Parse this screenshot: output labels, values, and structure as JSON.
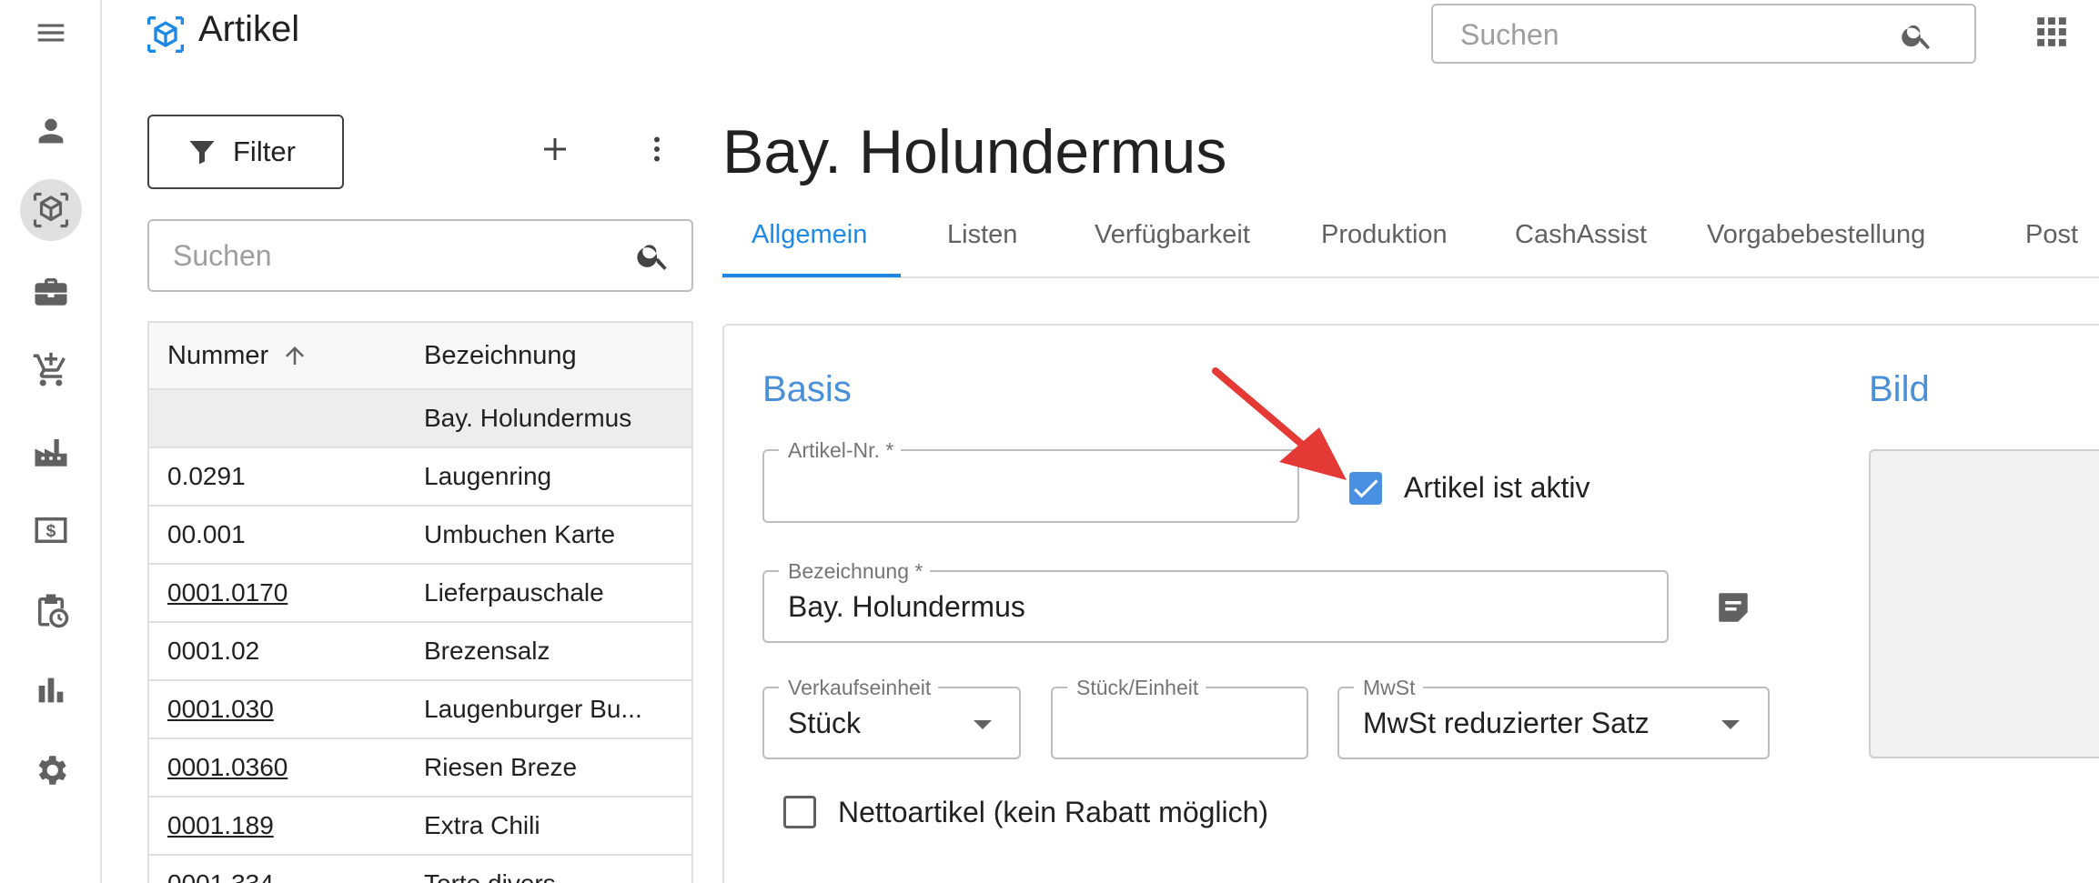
{
  "app": {
    "title": "Artikel"
  },
  "header": {
    "search_placeholder": "Suchen"
  },
  "rail": {
    "items": [
      "menu-icon",
      "person-icon",
      "article-icon",
      "briefcase-icon",
      "cart-icon",
      "factory-icon",
      "money-icon",
      "clipboard-clock-icon",
      "bar-chart-icon",
      "gear-icon"
    ],
    "active": "article-icon"
  },
  "list": {
    "filter_label": "Filter",
    "search_placeholder": "Suchen",
    "columns": {
      "number": "Nummer",
      "name": "Bezeichnung"
    },
    "rows": [
      {
        "number": "",
        "name": "Bay. Holundermus",
        "link": false,
        "selected": true
      },
      {
        "number": "0.0291",
        "name": "Laugenring",
        "link": false,
        "selected": false
      },
      {
        "number": "00.001",
        "name": "Umbuchen Karte",
        "link": false,
        "selected": false
      },
      {
        "number": "0001.0170",
        "name": "Lieferpauschale",
        "link": true,
        "selected": false
      },
      {
        "number": "0001.02",
        "name": "Brezensalz",
        "link": false,
        "selected": false
      },
      {
        "number": "0001.030",
        "name": "Laugenburger Bu...",
        "link": true,
        "selected": false
      },
      {
        "number": "0001.0360",
        "name": "Riesen Breze",
        "link": true,
        "selected": false
      },
      {
        "number": "0001.189",
        "name": "Extra Chili",
        "link": true,
        "selected": false
      },
      {
        "number": "0001.334",
        "name": "Torte divers",
        "link": false,
        "selected": false
      }
    ]
  },
  "detail": {
    "title": "Bay. Holundermus",
    "tabs": [
      "Allgemein",
      "Listen",
      "Verfügbarkeit",
      "Produktion",
      "CashAssist",
      "Vorgabebestellung",
      "Post"
    ],
    "active_tab": "Allgemein",
    "basis": {
      "section_title": "Basis",
      "artikel_nr_label": "Artikel-Nr. *",
      "artikel_nr_value": "",
      "aktiv_label": "Artikel ist aktiv",
      "aktiv_checked": true,
      "bezeichnung_label": "Bezeichnung *",
      "bezeichnung_value": "Bay. Holundermus",
      "verkaufseinheit_label": "Verkaufseinheit",
      "verkaufseinheit_value": "Stück",
      "stueck_label": "Stück/Einheit",
      "stueck_value": "",
      "mwst_label": "MwSt",
      "mwst_value": "MwSt reduzierter Satz",
      "netto_label": "Nettoartikel (kein Rabatt möglich)",
      "netto_checked": false
    },
    "bild": {
      "section_title": "Bild"
    }
  },
  "colors": {
    "accent": "#1e88e5",
    "section": "#4a90d9",
    "checkbox": "#4a90e2",
    "annotation_arrow": "#e53935"
  }
}
